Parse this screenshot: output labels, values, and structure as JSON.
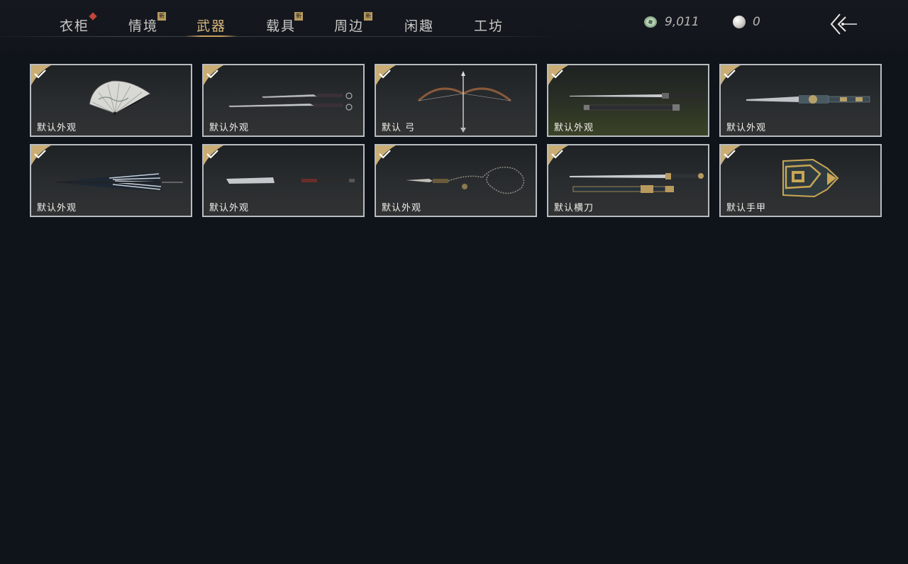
{
  "tabs": [
    {
      "label": "衣柜",
      "badge": "dot"
    },
    {
      "label": "情境",
      "badge": "新"
    },
    {
      "label": "武器",
      "badge": "",
      "active": true
    },
    {
      "label": "载具",
      "badge": "新"
    },
    {
      "label": "周边",
      "badge": "新"
    },
    {
      "label": "闲趣",
      "badge": ""
    },
    {
      "label": "工坊",
      "badge": ""
    }
  ],
  "currency": {
    "jade_coin": "9,011",
    "pearl": "0"
  },
  "items": [
    {
      "label": "默认外观",
      "icon": "folding-fan",
      "equipped": true
    },
    {
      "label": "默认外观",
      "icon": "twin-swords",
      "equipped": true
    },
    {
      "label": "默认 弓",
      "icon": "bow",
      "equipped": true
    },
    {
      "label": "默认外观",
      "icon": "long-sword",
      "equipped": true
    },
    {
      "label": "默认外观",
      "icon": "mechanical-blade",
      "equipped": true
    },
    {
      "label": "默认外观",
      "icon": "umbrella",
      "equipped": true
    },
    {
      "label": "默认外观",
      "icon": "glaive-spear",
      "equipped": true
    },
    {
      "label": "默认外观",
      "icon": "rope-dart",
      "equipped": true
    },
    {
      "label": "默认横刀",
      "icon": "horizontal-saber",
      "equipped": true
    },
    {
      "label": "默认手甲",
      "icon": "gauntlet",
      "equipped": true
    }
  ],
  "colors": {
    "accent": "#d9b77c",
    "check": "#c9ad74",
    "card_border": "#b9bcbf",
    "background": "#0f131a"
  }
}
